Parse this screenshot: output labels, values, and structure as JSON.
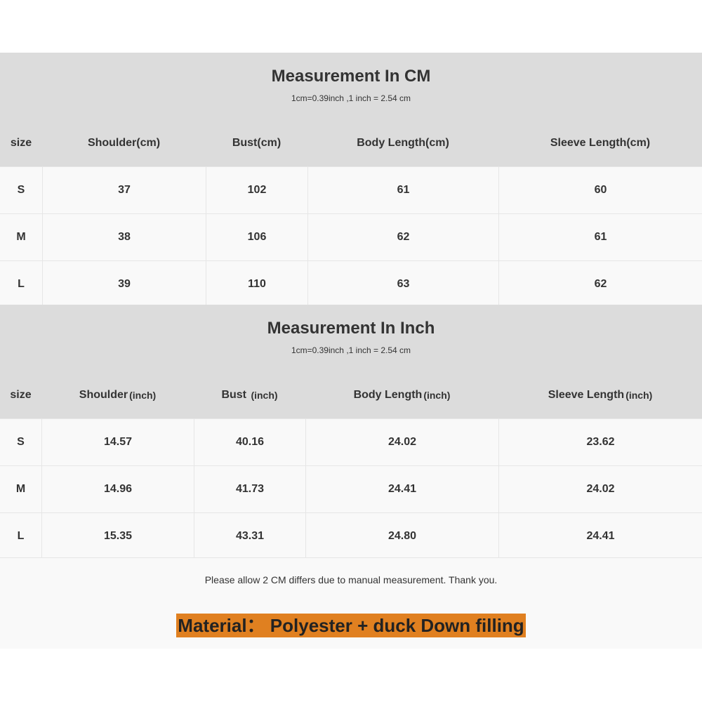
{
  "cm_table": {
    "title": "Measurement In CM",
    "subtitle": "1cm=0.39inch ,1 inch = 2.54 cm",
    "headers": [
      "size",
      "Shoulder(cm)",
      "Bust(cm)",
      "Body Length(cm)",
      "Sleeve Length(cm)"
    ],
    "rows": [
      [
        "S",
        "37",
        "102",
        "61",
        "60"
      ],
      [
        "M",
        "38",
        "106",
        "62",
        "61"
      ],
      [
        "L",
        "39",
        "110",
        "63",
        "62"
      ]
    ]
  },
  "inch_table": {
    "title": "Measurement In Inch",
    "subtitle": "1cm=0.39inch ,1 inch = 2.54 cm",
    "headers": [
      {
        "main": "size",
        "unit": ""
      },
      {
        "main": "Shoulder",
        "unit": "(inch)"
      },
      {
        "main": "Bust ",
        "unit": "(inch)"
      },
      {
        "main": "Body Length",
        "unit": "(inch)"
      },
      {
        "main": "Sleeve Length",
        "unit": "(inch)"
      }
    ],
    "rows": [
      [
        "S",
        "14.57",
        "40.16",
        "24.02",
        "23.62"
      ],
      [
        "M",
        "14.96",
        "41.73",
        "24.41",
        "24.02"
      ],
      [
        "L",
        "15.35",
        "43.31",
        "24.80",
        "24.41"
      ]
    ]
  },
  "note": "Please allow 2 CM differs due to manual measurement. Thank you.",
  "material": "Material： Polyester + duck Down filling",
  "colors": {
    "header_bg": "#dcdcdc",
    "row_bg": "#f9f9f9",
    "highlight": "#e08020"
  }
}
